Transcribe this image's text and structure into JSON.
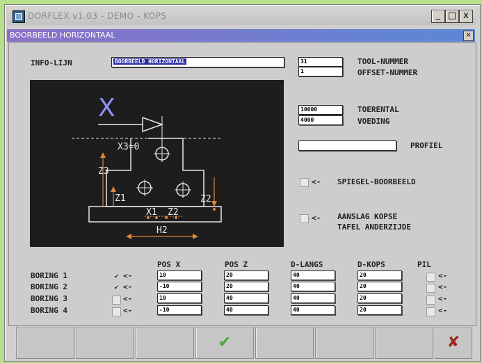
{
  "window": {
    "title": "DORFLEX v1.03 - DEMO - KOPS"
  },
  "window_controls": {
    "minimize": "_",
    "maximize": "□",
    "close": "x"
  },
  "dialog": {
    "title": "BOORBEELD HORIZONTAAL",
    "close": "×"
  },
  "info": {
    "label": "INFO-LIJN",
    "value": "BOORBEELD HORIZONTAAL"
  },
  "tool": {
    "tool_nummer_label": "TOOL-NUMMER",
    "tool_nummer_value": "31",
    "offset_nummer_label": "OFFSET-NUMMER",
    "offset_nummer_value": "1",
    "toerental_label": "TOERENTAL",
    "toerental_value": "10000",
    "voeding_label": "VOEDING",
    "voeding_value": "4000",
    "profiel_label": "PROFIEL",
    "profiel_value": ""
  },
  "options": {
    "arrow": "<-",
    "spiegel_label": "SPIEGEL-BOORBEELD",
    "aanslag_line1": "AANSLAG KOPSE",
    "aanslag_line2": "TAFEL ANDERZIJDE"
  },
  "diagram": {
    "x_label": "X",
    "x3_label": "X3=0",
    "z3_label": "Z3",
    "z1_label": "Z1",
    "x1_label": "X1",
    "z2_label_bottom": "Z2",
    "z2_label_side": "Z2",
    "h2_label": "H2"
  },
  "borings": {
    "headers": {
      "pos_x": "POS X",
      "pos_z": "POS Z",
      "d_langs": "D-LANGS",
      "d_kops": "D-KOPS",
      "pil": "PIL"
    },
    "rows": [
      {
        "label": "BORING 1",
        "checked": true,
        "check": "✔",
        "pos_x": "10",
        "pos_z": "20",
        "d_langs": "40",
        "d_kops": "20"
      },
      {
        "label": "BORING 2",
        "checked": true,
        "check": "✔",
        "pos_x": "-10",
        "pos_z": "20",
        "d_langs": "40",
        "d_kops": "20"
      },
      {
        "label": "BORING 3",
        "checked": false,
        "check": "",
        "pos_x": "10",
        "pos_z": "40",
        "d_langs": "40",
        "d_kops": "20"
      },
      {
        "label": "BORING 4",
        "checked": false,
        "check": "",
        "pos_x": "-10",
        "pos_z": "40",
        "d_langs": "40",
        "d_kops": "20"
      }
    ]
  },
  "buttons": {
    "ok_symbol": "✔",
    "cancel_symbol": "✘"
  },
  "colors": {
    "accent_green": "#4fa43a",
    "cancel_red": "#a0281e",
    "diagram_bg": "#1d1d1d",
    "diagram_orange": "#e0873a",
    "title_gradient_start": "#8b6fc6",
    "title_gradient_end": "#5b88d6"
  }
}
